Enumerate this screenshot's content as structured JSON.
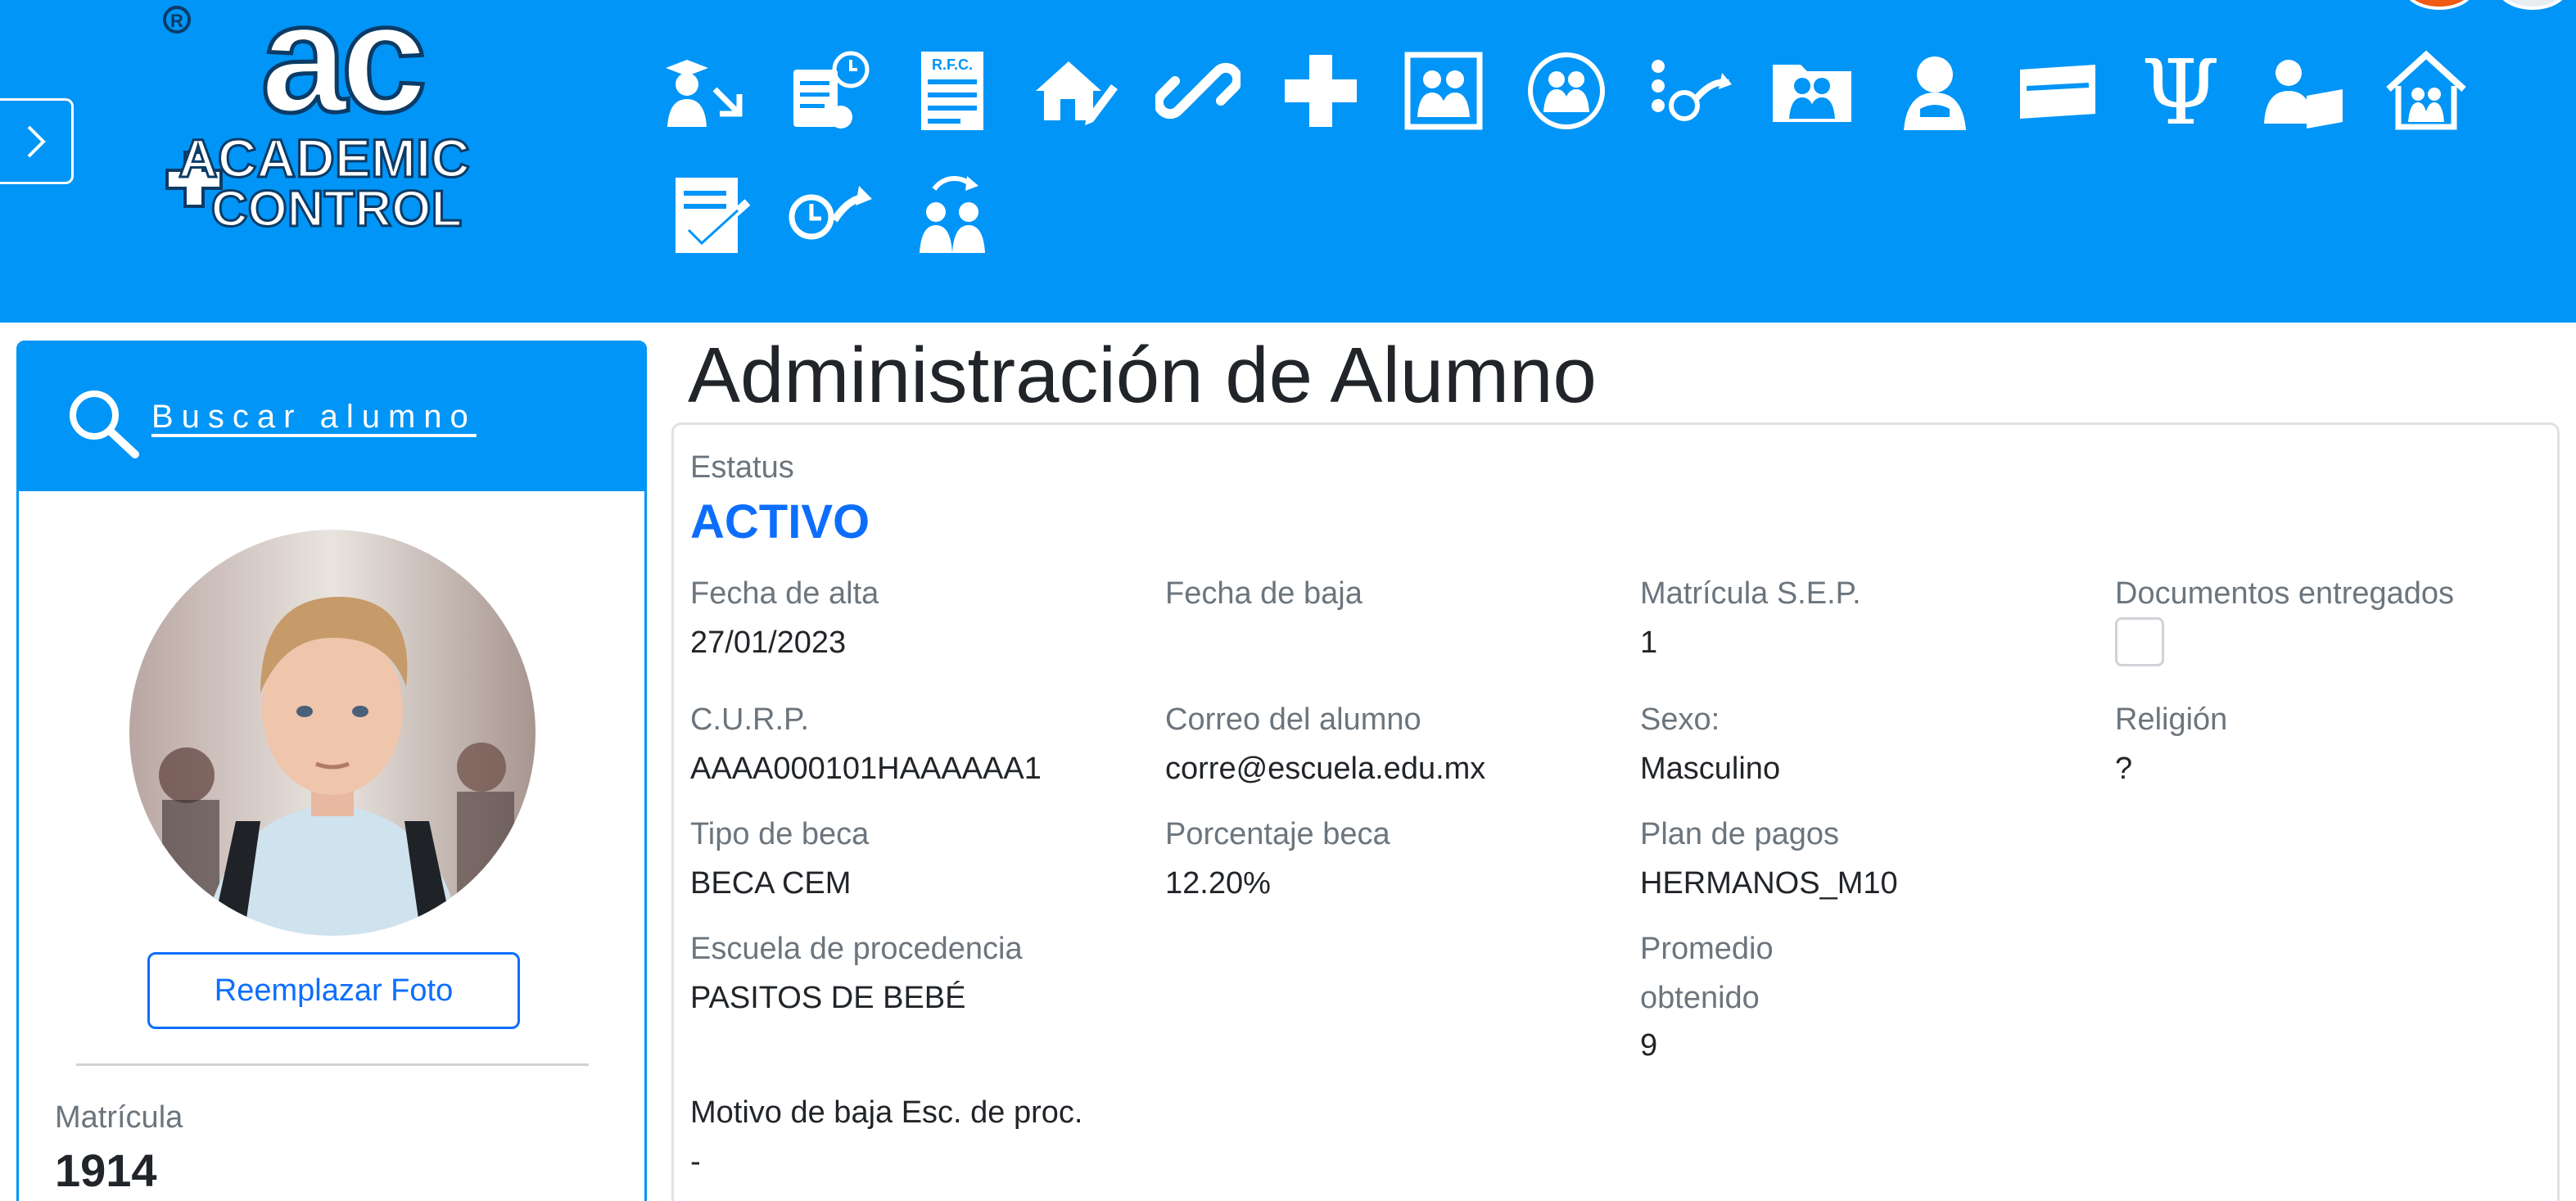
{
  "header": {
    "logo_text": [
      "ACADEMIC",
      "CONTROL"
    ],
    "logo_mark": "ac",
    "modules": [
      "graduate-transfer-icon",
      "document-clock-icon",
      "rfc-document-icon",
      "house-edit-icon",
      "link-icon",
      "plus-icon",
      "family-photo-icon",
      "family-circle-icon",
      "schedule-route-icon",
      "family-folder-icon",
      "counseling-icon",
      "card-icon",
      "psi-icon",
      "teacher-icon",
      "home-family-icon",
      "checklist-icon",
      "clock-arrow-icon",
      "user-rotate-icon"
    ],
    "rfc_text": "R.F.C.",
    "psi_glyph": "Ψ"
  },
  "sidebar": {
    "search_link": "Buscar alumno",
    "replace_photo_button": "Reemplazar Foto",
    "matricula_label": "Matrícula",
    "matricula_value": "1914"
  },
  "main": {
    "title": "Administración de Alumno",
    "status_label": "Estatus",
    "status_value": "ACTIVO",
    "fields": {
      "fecha_alta_label": "Fecha de alta",
      "fecha_alta_value": "27/01/2023",
      "fecha_baja_label": "Fecha de baja",
      "fecha_baja_value": "",
      "matricula_sep_label": "Matrícula S.E.P.",
      "matricula_sep_value": "1",
      "documentos_label": "Documentos entregados",
      "curp_label": "C.U.R.P.",
      "curp_value": "AAAA000101HAAAAAA1",
      "correo_label": "Correo del alumno",
      "correo_value": "corre@escuela.edu.mx",
      "sexo_label": "Sexo:",
      "sexo_value": "Masculino",
      "religion_label": "Religión",
      "religion_value": "?",
      "tipo_beca_label": "Tipo de beca",
      "tipo_beca_value": "BECA CEM",
      "porcentaje_beca_label": "Porcentaje beca",
      "porcentaje_beca_value": "12.20%",
      "plan_pagos_label": "Plan de pagos",
      "plan_pagos_value": "HERMANOS_M10",
      "escuela_label": "Escuela de procedencia",
      "escuela_value": "PASITOS DE BEBÉ",
      "promedio_label_1": "Promedio",
      "promedio_label_2": "obtenido",
      "promedio_value": "9",
      "motivo_label": "Motivo de baja Esc. de proc.",
      "motivo_value": "-"
    }
  },
  "colors": {
    "header_blue": "#0095f6",
    "status_blue": "#0d6efd",
    "label_gray": "#6c757d"
  }
}
